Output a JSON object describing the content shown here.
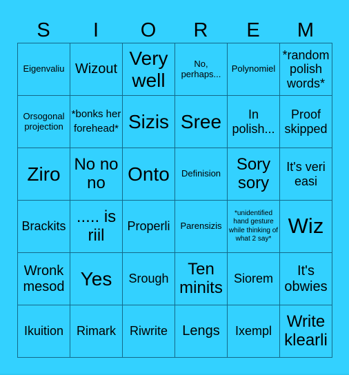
{
  "title_letters": [
    "S",
    "I",
    "O",
    "R",
    "E",
    "M"
  ],
  "colors": {
    "background": "#33d1ff",
    "grid_line": "#14698a",
    "text": "#000000"
  },
  "board": [
    [
      {
        "text": "Eigenvaliu",
        "size": "s-s"
      },
      {
        "text": "Wizout",
        "size": "s-ml"
      },
      {
        "text": "Very well",
        "size": "s-xl"
      },
      {
        "text": "No, perhaps...",
        "size": "s-s"
      },
      {
        "text": "Polynomiel",
        "size": "s-s"
      },
      {
        "text": "*random polish words*",
        "size": "s-m"
      }
    ],
    [
      {
        "text": "Orsogonal projection",
        "size": "s-s"
      },
      {
        "text": "*bonks her forehead*",
        "size": "s-sm"
      },
      {
        "text": "Sizis",
        "size": "s-xl"
      },
      {
        "text": "Sree",
        "size": "s-xl"
      },
      {
        "text": "In polish...",
        "size": "s-m"
      },
      {
        "text": "Proof skipped",
        "size": "s-m"
      }
    ],
    [
      {
        "text": "Ziro",
        "size": "s-xl"
      },
      {
        "text": "No no no",
        "size": "s-l"
      },
      {
        "text": "Onto",
        "size": "s-xl"
      },
      {
        "text": "Definision",
        "size": "s-s"
      },
      {
        "text": "Sory sory",
        "size": "s-l"
      },
      {
        "text": "It's veri easi",
        "size": "s-m"
      }
    ],
    [
      {
        "text": "Brackits",
        "size": "s-m"
      },
      {
        "text": "..... is riil",
        "size": "s-l"
      },
      {
        "text": "Properli",
        "size": "s-m"
      },
      {
        "text": "Parensizis",
        "size": "s-s"
      },
      {
        "text": "*unidentified hand gesture while thinking of what 2 say*",
        "size": "s-xs"
      },
      {
        "text": "Wiz",
        "size": "s-xxl"
      }
    ],
    [
      {
        "text": "Wronk mesod",
        "size": "s-ml"
      },
      {
        "text": "Yes",
        "size": "s-xl"
      },
      {
        "text": "Srough",
        "size": "s-m"
      },
      {
        "text": "Ten minits",
        "size": "s-l"
      },
      {
        "text": "Siorem",
        "size": "s-m"
      },
      {
        "text": "It's obwies",
        "size": "s-ml"
      }
    ],
    [
      {
        "text": "Ikuition",
        "size": "s-m"
      },
      {
        "text": "Rimark",
        "size": "s-m"
      },
      {
        "text": "Riwrite",
        "size": "s-m"
      },
      {
        "text": "Lengs",
        "size": "s-ml"
      },
      {
        "text": "Ixempl",
        "size": "s-m"
      },
      {
        "text": "Write klearli",
        "size": "s-l"
      }
    ]
  ]
}
